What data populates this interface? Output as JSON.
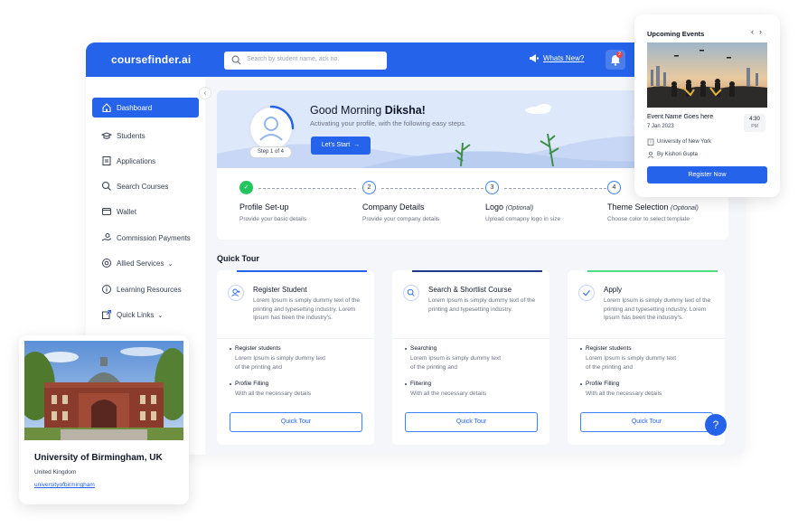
{
  "app": {
    "logo": "coursefinder.ai",
    "search_placeholder": "Search by student name, ack no.",
    "whats_new": "Whats New?",
    "notification_count": "2"
  },
  "sidebar": {
    "items": [
      {
        "label": "Dashboard",
        "icon": "home-icon",
        "active": true
      },
      {
        "label": "Students",
        "icon": "graduation-cap-icon"
      },
      {
        "label": "Applications",
        "icon": "document-icon"
      },
      {
        "label": "Search Courses",
        "icon": "search-icon"
      },
      {
        "label": "Wallet",
        "icon": "wallet-icon"
      },
      {
        "label": "Commission Payments",
        "icon": "hand-coin-icon"
      },
      {
        "label": "Allied Services",
        "icon": "settings-icon",
        "expandable": true
      },
      {
        "label": "Learning Resources",
        "icon": "info-icon"
      },
      {
        "label": "Quick Links",
        "icon": "external-link-icon",
        "expandable": true
      }
    ]
  },
  "banner": {
    "greeting_prefix": "Good Morning ",
    "user_name": "Diksha!",
    "subtitle": "Activating your profile, with the following easy steps.",
    "cta": "Let's Start",
    "step_pill": "Step 1 of 4",
    "progress_fraction": 0.25
  },
  "steps": [
    {
      "num": "",
      "title": "Profile Set-up",
      "optional": "",
      "desc": "Provide your basic details",
      "done": true
    },
    {
      "num": "2",
      "title": "Company Details",
      "optional": "",
      "desc": "Provide your company details"
    },
    {
      "num": "3",
      "title": "Logo ",
      "optional": "(Optional)",
      "desc": "Upload comapny logo in size"
    },
    {
      "num": "4",
      "title": "Theme Selection ",
      "optional": "(Optional)",
      "desc": "Choose color to select template"
    }
  ],
  "quick_tour": {
    "title": "Quick Tour",
    "button_label": "Quick Tour",
    "cards": [
      {
        "title": "Register Student",
        "icon": "add-user-icon",
        "accent": "#2563eb",
        "desc": "Lorem Ipsum is simply dummy text of the printing and typesetting industry. Lorem Ipsum has been the industry's.",
        "h1": "Register students",
        "s1a": "Lorem Ipsum is simply dummy text",
        "s1b": "of the printing and",
        "h2": "Profile Filling",
        "s2": "With all the necessary details"
      },
      {
        "title": "Search & Shortlist Course",
        "icon": "search-icon",
        "accent": "#1e3a8a",
        "desc": "Lorem Ipsum is simply dummy text of the printing and typesetting industry.",
        "h1": "Searching",
        "s1a": "Lorem Ipsum is simply dummy text",
        "s1b": "of the printing and",
        "h2": "Filtering",
        "s2": "With all the necessary details"
      },
      {
        "title": "Apply",
        "icon": "check-icon",
        "accent": "#4ade80",
        "desc": "Lorem Ipsum is simply dummy text of the printing and typesetting industry. Lorem Ipsum has been the industry's.",
        "h1": "Register students",
        "s1a": "Lorem Ipsum is simply dummy text",
        "s1b": "of the printing and",
        "h2": "Profile Filling",
        "s2": "With all the necessary details"
      }
    ]
  },
  "help": "?",
  "events": {
    "title": "Upcoming Events",
    "prev": "‹",
    "next": "›",
    "name": "Event Name Goes here",
    "date": "7 Jan 2023",
    "time": "4:30",
    "ampm": "PM",
    "venue": "University of New York",
    "by": "By  Kishori Gupta",
    "button": "Register Now"
  },
  "university": {
    "name": "University of Birmingham, UK",
    "country": "United Kingdom",
    "link": "universityofbirmingham"
  }
}
